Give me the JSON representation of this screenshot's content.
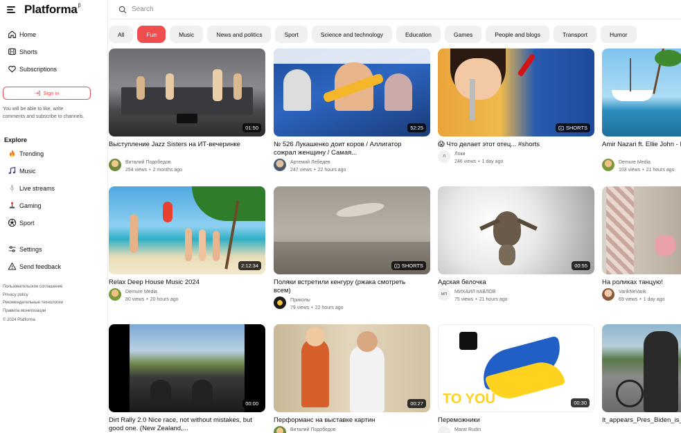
{
  "app": {
    "logo": "Platforma",
    "logo_sup": "β",
    "search_placeholder": "Search"
  },
  "sidebar": {
    "main": [
      {
        "label": "Home",
        "icon": "home-icon"
      },
      {
        "label": "Shorts",
        "icon": "shorts-icon"
      },
      {
        "label": "Subscriptions",
        "icon": "heart-icon"
      }
    ],
    "signin_label": "Sign in",
    "signin_note": "You will be able to like, write comments and subscribe to channels.",
    "explore_title": "Explore",
    "explore": [
      {
        "label": "Trending",
        "icon": "flame-icon"
      },
      {
        "label": "Music",
        "icon": "music-note-icon"
      },
      {
        "label": "Live streams",
        "icon": "microphone-icon"
      },
      {
        "label": "Gaming",
        "icon": "joystick-icon"
      },
      {
        "label": "Sport",
        "icon": "soccer-ball-icon"
      }
    ],
    "bottom": [
      {
        "label": "Settings",
        "icon": "settings-sliders-icon"
      },
      {
        "label": "Send feedback",
        "icon": "warning-triangle-icon"
      }
    ],
    "footer_links": [
      "Пользовательское соглашение",
      "Privacy policy",
      "Рекомендательные технологии",
      "Правила монетизации"
    ],
    "copyright": "© 2024 Platforma"
  },
  "chips": [
    {
      "label": "All",
      "active": false
    },
    {
      "label": "Fun",
      "active": true
    },
    {
      "label": "Music",
      "active": false
    },
    {
      "label": "News and politics",
      "active": false
    },
    {
      "label": "Sport",
      "active": false
    },
    {
      "label": "Science and technology",
      "active": false
    },
    {
      "label": "Education",
      "active": false
    },
    {
      "label": "Games",
      "active": false
    },
    {
      "label": "People and blogs",
      "active": false
    },
    {
      "label": "Transport",
      "active": false
    },
    {
      "label": "Humor",
      "active": false
    }
  ],
  "colors": {
    "accent": "#f04e4e",
    "chip_bg": "#f0f0f0"
  },
  "videos": [
    {
      "title": "Выступление Jazz Sisters на ИТ-вечеринке",
      "channel": "Виталий Подобедов",
      "views": "254 views",
      "age": "2 months ago",
      "badge": "01:50",
      "shorts": false
    },
    {
      "title": "№ 526 Лукашенко доит коров / Аллигатор сожрал женщину / Самая...",
      "channel": "Артемий Лебедев",
      "views": "247 views",
      "age": "22 hours ago",
      "badge": "52:25",
      "shorts": false
    },
    {
      "title": "😱 Что делает этот отец... #shorts",
      "channel": "Локи",
      "avatar_letter": "Л",
      "views": "246 views",
      "age": "1 day ago",
      "badge": "SHORTS",
      "shorts": true
    },
    {
      "title": "Amir Nazari ft. Ellie John - Rise Up",
      "channel": "Demure Media",
      "views": "103 views",
      "age": "21 hours ago",
      "badge": "",
      "shorts": false
    },
    {
      "title": "Relax Deep House Music 2024",
      "channel": "Demure Media",
      "views": "80 views",
      "age": "20 hours ago",
      "badge": "2:12:34",
      "shorts": false
    },
    {
      "title": "Поляки встретили кенгуру (ржака смотреть всем)",
      "channel": "Приколы",
      "views": "79 views",
      "age": "22 hours ago",
      "badge": "SHORTS",
      "shorts": true
    },
    {
      "title": "Адская белочка",
      "channel": "МИХАИЛ пАВЛОВ",
      "avatar_letter": "МП",
      "views": "75 views",
      "age": "21 hours ago",
      "badge": "00:55",
      "shorts": false
    },
    {
      "title": "На роликах танцую!",
      "channel": "VarikNeVarik",
      "views": "69 views",
      "age": "1 day ago",
      "badge": "",
      "shorts": false
    },
    {
      "title": "Dirt Rally 2.0 Nice race, not without mistakes, but good one. (New Zealand,...",
      "channel": "",
      "views": "",
      "age": "",
      "badge": "00:00",
      "shorts": false
    },
    {
      "title": "Перформанс на выставке картин",
      "channel": "Виталий Подобедов",
      "views": "",
      "age": "",
      "badge": "00:27",
      "shorts": false
    },
    {
      "title": "Переможники",
      "channel": "Marat Rudin",
      "views": "",
      "age": "",
      "badge": "00:30",
      "shorts": false
    },
    {
      "title": "It_appears_Pres_Biden_is_confused_when_he_fell_off_his_bike_",
      "channel": "",
      "views": "",
      "age": "",
      "badge": "",
      "shorts": false
    }
  ]
}
